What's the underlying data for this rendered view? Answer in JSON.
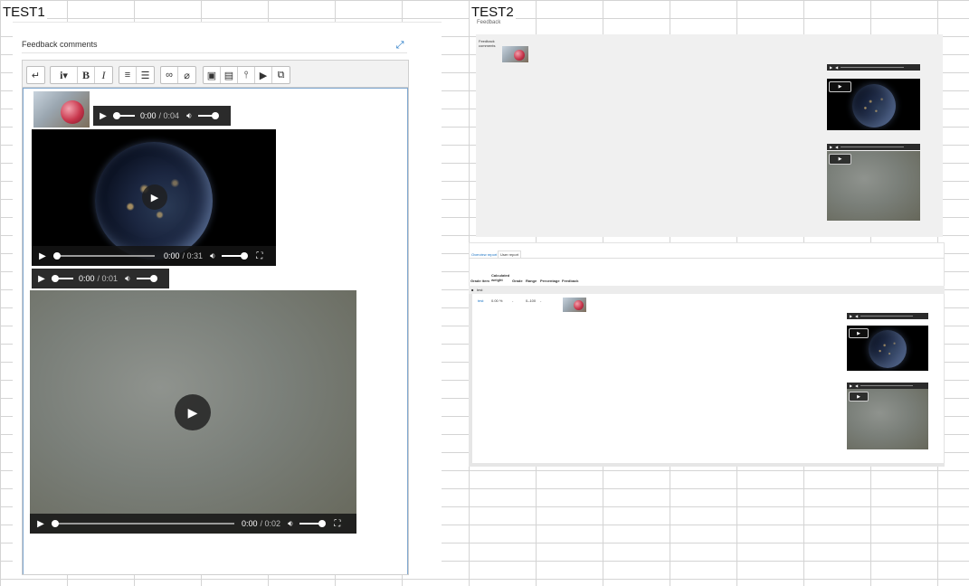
{
  "sheet": {
    "test1_label": "TEST1",
    "test2_label": "TEST2"
  },
  "test1": {
    "section_title": "Feedback comments",
    "expand_icon": "fullscreen-icon",
    "toolbar": [
      [
        "undo-icon"
      ],
      [
        "info-dropdown-icon",
        "bold-icon",
        "italic-icon"
      ],
      [
        "unordered-list-icon",
        "ordered-list-icon"
      ],
      [
        "link-icon",
        "unlink-icon"
      ],
      [
        "image-icon",
        "media-icon",
        "microphone-icon",
        "video-camera-icon",
        "manage-files-icon"
      ]
    ],
    "audio1": {
      "current": "0:00",
      "total": "/ 0:04"
    },
    "video1": {
      "current": "0:00",
      "total": "/ 0:31"
    },
    "audio2": {
      "current": "0:00",
      "total": "/ 0:01"
    },
    "video2": {
      "current": "0:00",
      "total": "/ 0:02"
    }
  },
  "test2": {
    "feedback_heading": "Feedback",
    "feedback_comments_label": "Feedback comments",
    "tabs": [
      "Overview report",
      "User report"
    ],
    "table_headers": [
      "Grade item",
      "Calculated weight",
      "Grade",
      "Range",
      "Percentage",
      "Feedback"
    ],
    "category_row": "test",
    "item_row": {
      "name": "test",
      "weight": "0.00 %",
      "grade": "-",
      "range": "0–100",
      "percentage": "-"
    }
  }
}
